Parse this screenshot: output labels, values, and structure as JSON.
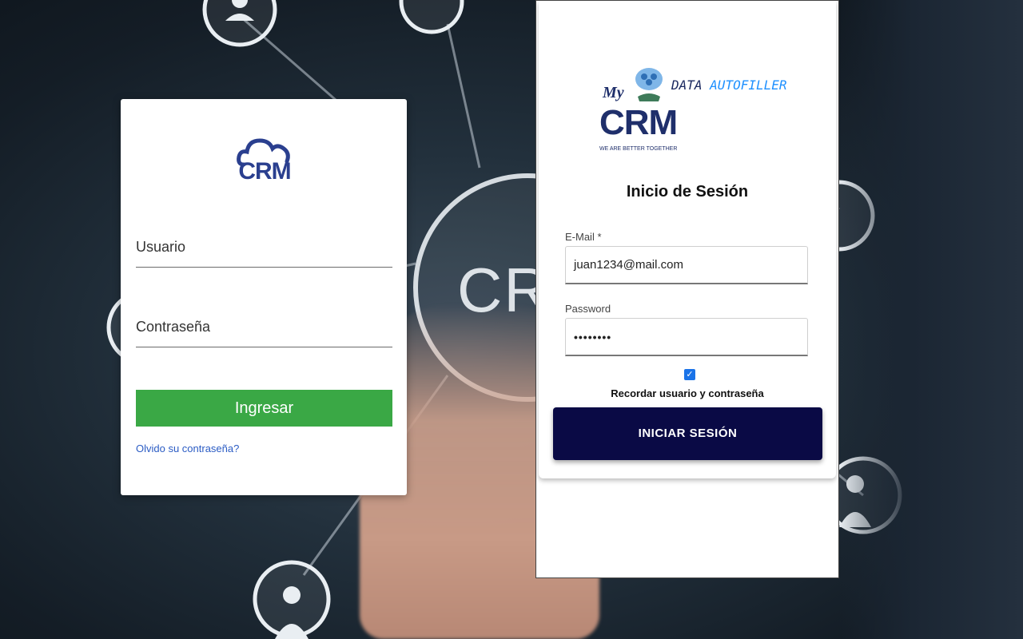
{
  "background": {
    "crm_text": "CRI"
  },
  "left_login": {
    "logo_text": "CRM",
    "username_placeholder": "Usuario",
    "password_placeholder": "Contraseña",
    "submit_label": "Ingresar",
    "forgot_link": "Olvido su contraseña?",
    "accent_color": "#3aa845",
    "logo_color": "#2a3f8f"
  },
  "right_login": {
    "brand": {
      "my": "My",
      "crm": "CRM",
      "tagline": "WE ARE BETTER TOGETHER"
    },
    "extension_name": {
      "part1": "DATA",
      "part2": "AUTOFILLER"
    },
    "title": "Inicio de Sesión",
    "email_label": "E-Mail *",
    "email_value": "juan1234@mail.com",
    "password_label": "Password",
    "password_value": "••••••••",
    "remember_checked": true,
    "remember_label": "Recordar usuario y contraseña",
    "submit_label": "INICIAR SESIÓN",
    "button_color": "#0a0a45"
  }
}
